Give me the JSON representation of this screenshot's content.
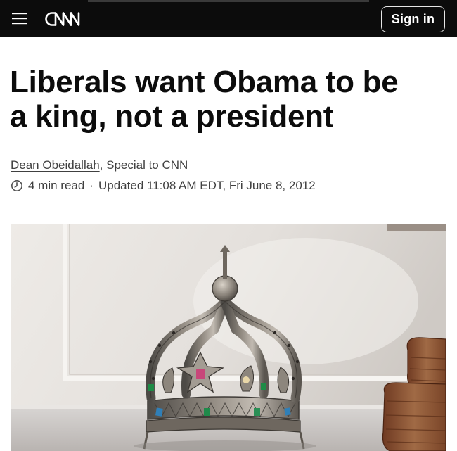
{
  "header": {
    "logo_text": "CNN",
    "signin_label": "Sign in",
    "colors": {
      "bar": "#0c0c0c",
      "text": "#ffffff"
    }
  },
  "article": {
    "headline_line1": "Liberals want Obama to be",
    "headline_line2": "a king, not a president",
    "author": "Dean Obeidallah",
    "author_affiliation": ", Special to CNN",
    "read_time": "4 min read",
    "separator": "·",
    "updated": "Updated 11:08 AM EDT, Fri June 8, 2012"
  },
  "hero_image": {
    "subject": "ornate silver crown with colored jewels on a table, books at right"
  },
  "icons": {
    "menu": "hamburger-menu-icon",
    "clock": "clock-icon"
  }
}
